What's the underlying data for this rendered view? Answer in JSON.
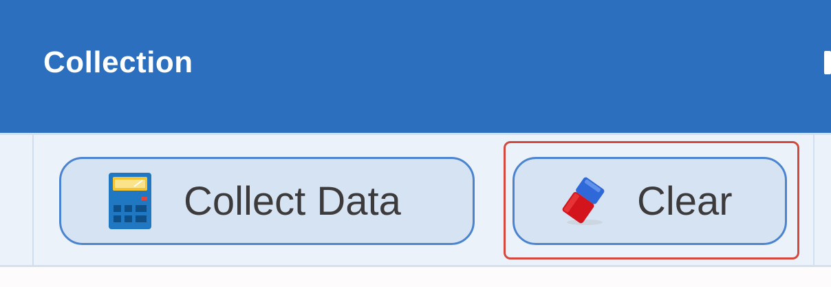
{
  "ribbon": {
    "group_title": "Collection"
  },
  "toolbar": {
    "buttons": [
      {
        "label": "Collect Data",
        "icon": "calculator-icon"
      },
      {
        "label": "Clear",
        "icon": "eraser-icon"
      }
    ]
  },
  "colors": {
    "header": "#2c6fbe",
    "toolbar": "#ebf2fa",
    "button_fill": "#d5e3f2",
    "button_border": "#4a84d0",
    "focus_highlight": "#d5483e"
  }
}
